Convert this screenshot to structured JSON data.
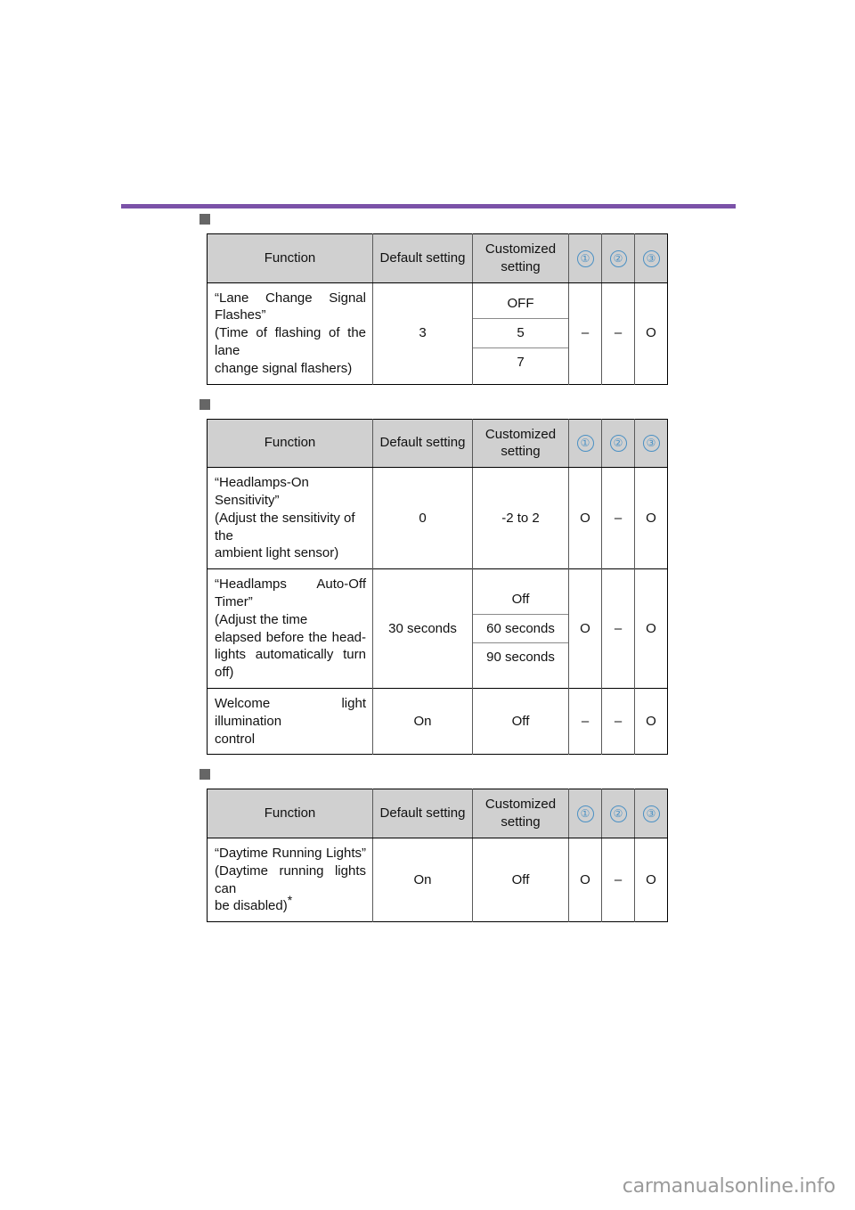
{
  "page": {
    "background_color": "#ffffff",
    "header_rule_color": "#7B52A8",
    "section_marker_color": "#666666",
    "header_fill_color": "#d0d0d0",
    "circled_number_color": "#4A90C4"
  },
  "columns": {
    "function": "Function",
    "default_setting": "Default setting",
    "customized_setting": "Customized setting",
    "mark1": "①",
    "mark2": "②",
    "mark3": "③"
  },
  "tables": [
    {
      "marker": "section-marker",
      "rows": [
        {
          "function_lines": [
            "“Lane     Change     Signal",
            "Flashes”",
            "(Time of flashing of the lane",
            "change signal flashers)"
          ],
          "default": "3",
          "customized": [
            "OFF",
            "5",
            "7"
          ],
          "mark1": "–",
          "mark2": "–",
          "mark3": "O"
        }
      ]
    },
    {
      "marker": "section-marker",
      "rows": [
        {
          "function_lines": [
            "“Headlamps-On Sensitivity”",
            "(Adjust the sensitivity of the",
            "ambient light sensor)"
          ],
          "default": "0",
          "customized": [
            "-2 to 2"
          ],
          "mark1": "O",
          "mark2": "–",
          "mark3": "O"
        },
        {
          "function_lines": [
            "“Headlamps         Auto-Off",
            "Timer”",
            "(Adjust the time",
            "elapsed  before  the  head-",
            "lights automatically turn off)"
          ],
          "default": "30 seconds",
          "customized": [
            "Off",
            "60 seconds",
            "90 seconds"
          ],
          "mark1": "O",
          "mark2": "–",
          "mark3": "O"
        },
        {
          "function_lines": [
            "Welcome  light  illumination",
            "control"
          ],
          "default": "On",
          "customized": [
            "Off"
          ],
          "mark1": "–",
          "mark2": "–",
          "mark3": "O"
        }
      ]
    },
    {
      "marker": "section-marker",
      "rows": [
        {
          "function_lines": [
            "“Daytime   Running   Lights”",
            "(Daytime running lights can",
            "be disabled)"
          ],
          "footnote_mark": "*",
          "default": "On",
          "customized": [
            "Off"
          ],
          "mark1": "O",
          "mark2": "–",
          "mark3": "O"
        }
      ]
    }
  ],
  "footer": {
    "watermark": "carmanualsonline.info"
  }
}
